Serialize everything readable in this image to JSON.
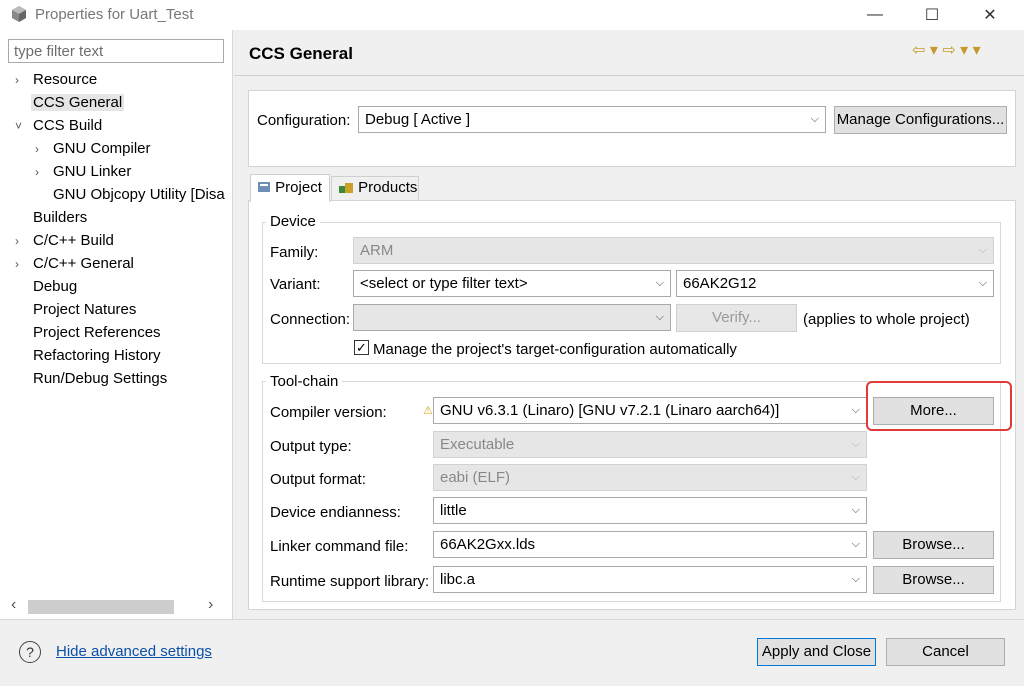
{
  "window": {
    "title": "Properties for Uart_Test",
    "minimize_glyph": "—",
    "maximize_glyph": "☐",
    "close_glyph": "✕"
  },
  "sidebar": {
    "filter_placeholder": "type filter text",
    "items": [
      {
        "label": "Resource",
        "chevron": "›"
      },
      {
        "label": "CCS General",
        "chevron": ""
      },
      {
        "label": "CCS Build",
        "chevron": "˅"
      },
      {
        "label": "GNU Compiler",
        "chevron": "›"
      },
      {
        "label": "GNU Linker",
        "chevron": "›"
      },
      {
        "label": "GNU Objcopy Utility  [Disa",
        "chevron": ""
      },
      {
        "label": "Builders",
        "chevron": ""
      },
      {
        "label": "C/C++ Build",
        "chevron": "›"
      },
      {
        "label": "C/C++ General",
        "chevron": "›"
      },
      {
        "label": "Debug",
        "chevron": ""
      },
      {
        "label": "Project Natures",
        "chevron": ""
      },
      {
        "label": "Project References",
        "chevron": ""
      },
      {
        "label": "Refactoring History",
        "chevron": ""
      },
      {
        "label": "Run/Debug Settings",
        "chevron": ""
      }
    ],
    "scroll_left": "‹",
    "scroll_right": "›"
  },
  "page": {
    "title": "CCS General",
    "nav": "⇦ ▾ ⇨ ▾ ▾"
  },
  "configuration": {
    "label": "Configuration:",
    "value": "Debug  [ Active ]",
    "manage_button": "Manage Configurations..."
  },
  "tabs": [
    {
      "label": "Project",
      "icon": "project-icon"
    },
    {
      "label": "Products",
      "icon": "products-icon"
    }
  ],
  "device": {
    "legend": "Device",
    "family_label": "Family:",
    "family_value": "ARM",
    "variant_label": "Variant:",
    "variant_filter": "<select or type filter text>",
    "variant_value": "66AK2G12",
    "connection_label": "Connection:",
    "connection_value": "",
    "verify_button": "Verify...",
    "applies_text": "(applies to whole project)",
    "manage_checkbox_label": "Manage the project's target-configuration automatically",
    "manage_checked": true
  },
  "toolchain": {
    "legend": "Tool-chain",
    "compiler_label": "Compiler version:",
    "compiler_value": "GNU v6.3.1 (Linaro)  [GNU v7.2.1 (Linaro aarch64)]",
    "more_button": "More...",
    "output_type_label": "Output type:",
    "output_type_value": "Executable",
    "output_format_label": "Output format:",
    "output_format_value": "eabi (ELF)",
    "endianness_label": "Device endianness:",
    "endianness_value": "little",
    "linker_label": "Linker command file:",
    "linker_value": "66AK2Gxx.lds",
    "linker_browse": "Browse...",
    "rts_label": "Runtime support library:",
    "rts_value": "libc.a",
    "rts_browse": "Browse..."
  },
  "footer": {
    "help_glyph": "?",
    "hide_advanced": "Hide advanced settings",
    "apply_close": "Apply and Close",
    "cancel": "Cancel"
  },
  "colors": {
    "highlight": "#e03a3a",
    "link": "#0b4fa8"
  }
}
